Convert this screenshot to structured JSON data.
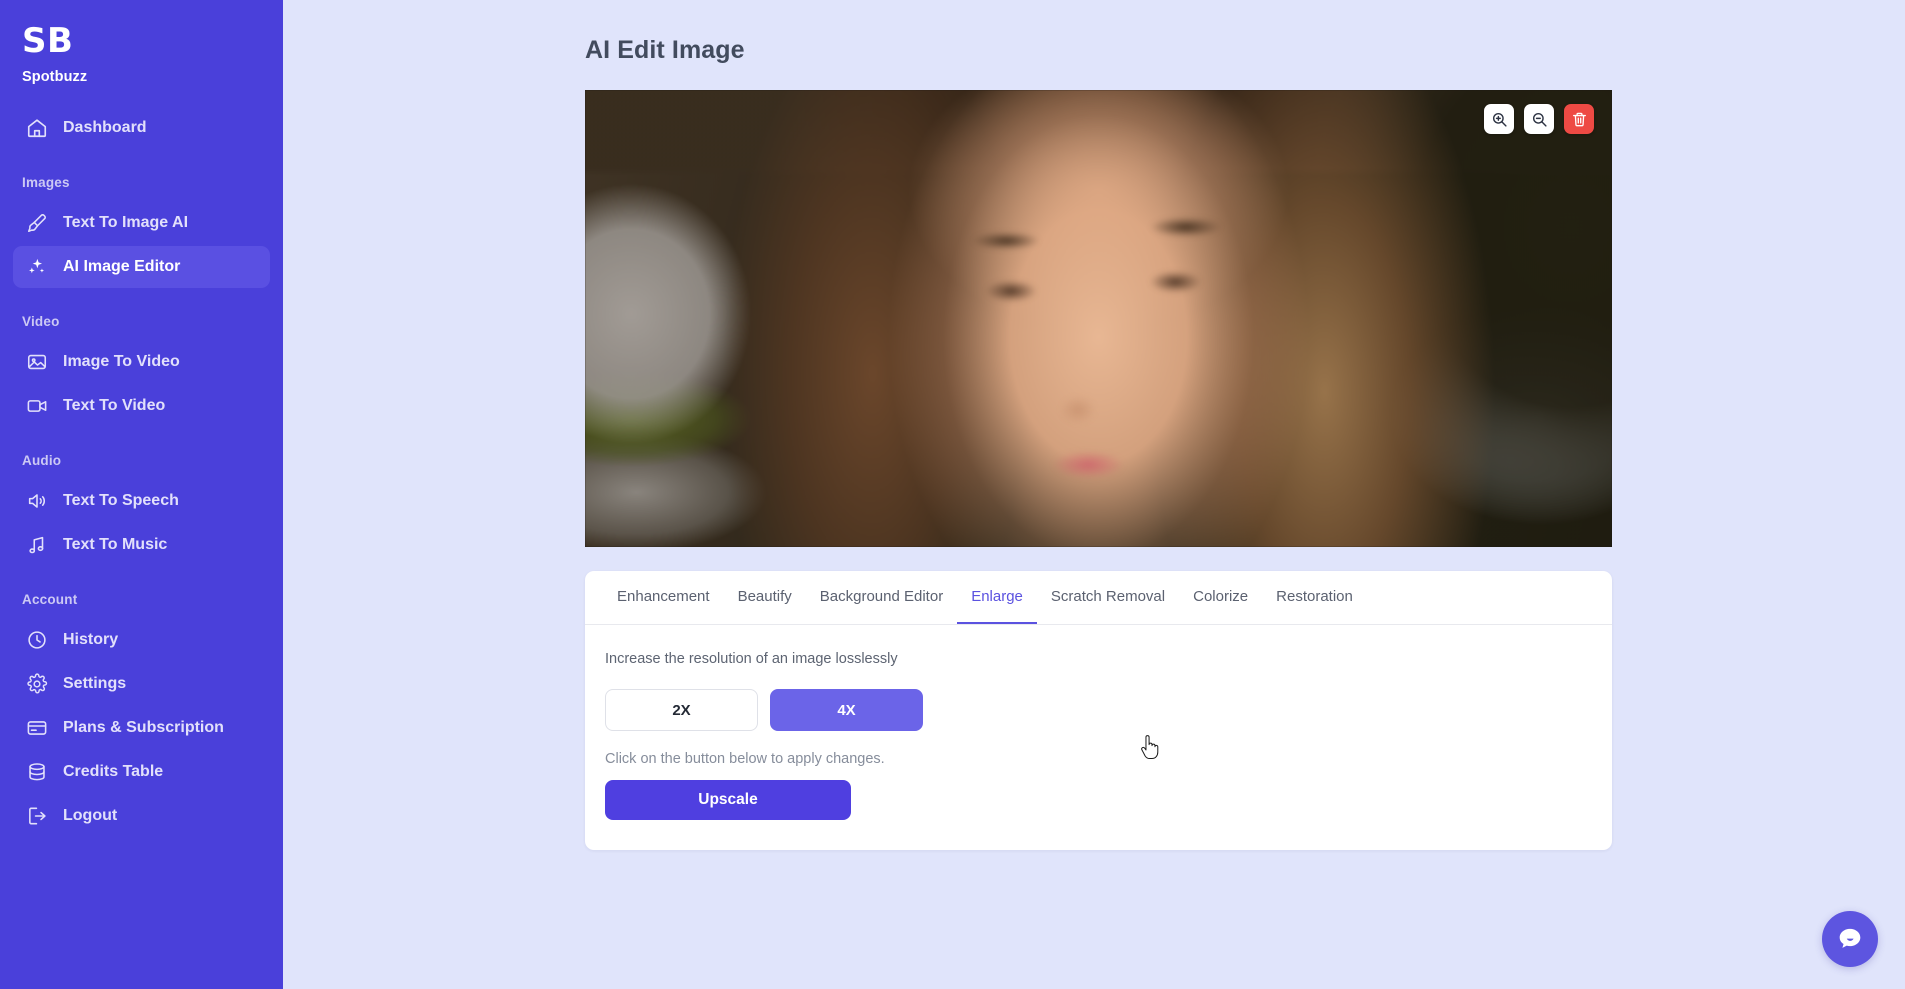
{
  "app": {
    "background_color": "#e0e4fb",
    "accent_color": "#4f3fe0",
    "danger_color": "#ee4a44"
  },
  "sidebar": {
    "logo_text": "SB",
    "brand_name": "Spotbuzz",
    "background_color": "#4a40da",
    "top_items": [
      {
        "label": "Dashboard",
        "icon": "home-icon",
        "active": false
      }
    ],
    "sections": [
      {
        "label": "Images",
        "items": [
          {
            "label": "Text To Image AI",
            "icon": "brush-icon",
            "active": false
          },
          {
            "label": "AI Image Editor",
            "icon": "sparkles-icon",
            "active": true
          }
        ]
      },
      {
        "label": "Video",
        "items": [
          {
            "label": "Image To Video",
            "icon": "image-icon",
            "active": false
          },
          {
            "label": "Text To Video",
            "icon": "video-camera-icon",
            "active": false
          }
        ]
      },
      {
        "label": "Audio",
        "items": [
          {
            "label": "Text To Speech",
            "icon": "speaker-icon",
            "active": false
          },
          {
            "label": "Text To Music",
            "icon": "music-note-icon",
            "active": false
          }
        ]
      },
      {
        "label": "Account",
        "items": [
          {
            "label": "History",
            "icon": "clock-icon",
            "active": false
          },
          {
            "label": "Settings",
            "icon": "gear-icon",
            "active": false
          },
          {
            "label": "Plans & Subscription",
            "icon": "credit-card-icon",
            "active": false
          },
          {
            "label": "Credits Table",
            "icon": "database-icon",
            "active": false
          },
          {
            "label": "Logout",
            "icon": "logout-icon",
            "active": false
          }
        ]
      }
    ]
  },
  "main": {
    "page_title": "AI Edit Image",
    "image_toolbar": [
      {
        "name": "zoom-in-button",
        "icon": "magnifier-plus-icon",
        "style": "light"
      },
      {
        "name": "zoom-out-button",
        "icon": "magnifier-minus-icon",
        "style": "light"
      },
      {
        "name": "delete-image-button",
        "icon": "trash-icon",
        "style": "danger"
      }
    ],
    "tabs": [
      {
        "label": "Enhancement",
        "active": false
      },
      {
        "label": "Beautify",
        "active": false
      },
      {
        "label": "Background Editor",
        "active": false
      },
      {
        "label": "Enlarge",
        "active": true
      },
      {
        "label": "Scratch Removal",
        "active": false
      },
      {
        "label": "Colorize",
        "active": false
      },
      {
        "label": "Restoration",
        "active": false
      }
    ],
    "panel": {
      "description": "Increase the resolution of an image losslessly",
      "scale_options": [
        {
          "label": "2X",
          "selected": false
        },
        {
          "label": "4X",
          "selected": true
        }
      ],
      "apply_note": "Click on the button below to apply changes.",
      "action_label": "Upscale"
    }
  },
  "chat": {
    "icon": "chat-bubble-icon"
  }
}
